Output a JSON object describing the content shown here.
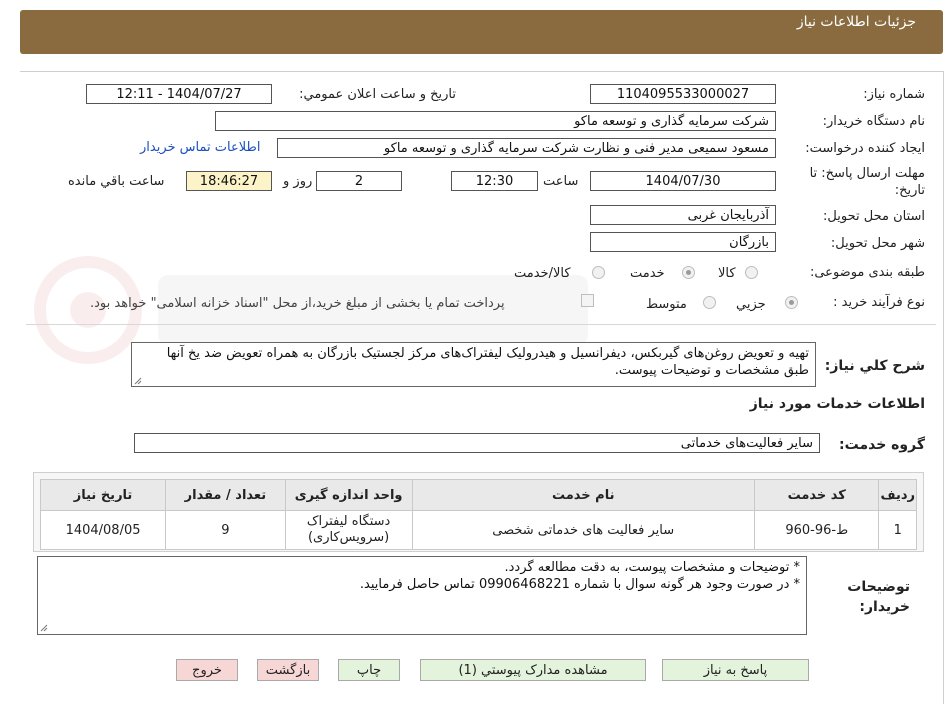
{
  "header": {
    "title": "جزئیات اطلاعات نیاز"
  },
  "form": {
    "need_number": {
      "label": "شماره نیاز:",
      "value": "1104095533000027"
    },
    "announce_datetime": {
      "label": "تاریخ و ساعت اعلان عمومي:",
      "value": "1404/07/27 - 12:11"
    },
    "buyer_org": {
      "label": "نام دستگاه خريدار:",
      "value": "شرکت سرمايه گذاری و توسعه ماکو"
    },
    "requester": {
      "label": "ايجاد کننده درخواست:",
      "value": "مسعود سميعی مدير فنی و نظارت   شرکت سرمايه گذاری و توسعه ماکو",
      "contact_link": "اطلاعات تماس خريدار"
    },
    "deadline": {
      "label": "مهلت ارسال پاسخ: تا تاريخ:",
      "date": "1404/07/30",
      "time_label": "ساعت",
      "time": "12:30",
      "days": "2",
      "days_label": "روز و",
      "remaining": "18:46:27",
      "remaining_label": "ساعت باقي مانده"
    },
    "province": {
      "label": "استان محل تحويل:",
      "value": "آذربايجان غربی"
    },
    "city": {
      "label": "شهر محل تحويل:",
      "value": "بازرگان"
    },
    "category": {
      "label": "طبقه بندی موضوعی:",
      "options": [
        "کالا",
        "خدمت",
        "کالا/خدمت"
      ],
      "selected": "خدمت"
    },
    "purchase_type": {
      "label": "نوع فرآيند خريد :",
      "options": [
        "جزيي",
        "متوسط"
      ],
      "selected": "جزيي",
      "treasury_note": "پرداخت تمام يا بخشی از مبلغ خريد،از محل \"اسناد خزانه اسلامی\" خواهد بود."
    },
    "description": {
      "label": "شرح کلي نياز:",
      "value": "تهيه و تعويض روغن‌های گيربکس، ديفرانسيل و هيدروليک ليفتراک‌های مرکز لجستيک بازرگان به همراه تعويض ضد يخ آنها طبق مشخصات و توضيحات پيوست."
    }
  },
  "services": {
    "section_title": "اطلاعات خدمات مورد نياز",
    "group_label": "گروه خدمت:",
    "group_value": "ساير فعاليت‌های خدماتی",
    "columns": [
      "رديف",
      "کد خدمت",
      "نام خدمت",
      "واحد اندازه گيری",
      "تعداد / مقدار",
      "تاريخ نياز"
    ],
    "rows": [
      {
        "row": "1",
        "code": "ط-96-960",
        "name": "ساير فعاليت های خدماتی شخصی",
        "unit": "دستگاه ليفتراک (سرويس‌کاری)",
        "qty": "9",
        "date": "1404/08/05"
      }
    ]
  },
  "buyer_notes": {
    "label": "توضيحات خريدار:",
    "lines": [
      "* توضيحات و مشخصات پيوست، به دقت مطالعه گردد.",
      "* در صورت وجود هر گونه سوال با شماره 09906468221 تماس حاصل فرماييد."
    ]
  },
  "buttons": {
    "reply": "پاسخ به نياز",
    "attachments": "مشاهده مدارک پيوستي (1)",
    "print": "چاپ",
    "back": "بازگشت",
    "exit": "خروج"
  },
  "colors": {
    "header_bg": "#8a6b3f",
    "link": "#1c4fbf",
    "remaining_bg": "#fdf3c8",
    "btn_green": "#e3f3dc",
    "btn_pink": "#f7d6d6"
  },
  "icons": {
    "radio": "radio-button",
    "checkbox": "checkbox",
    "resize": "resize-grip-icon"
  }
}
